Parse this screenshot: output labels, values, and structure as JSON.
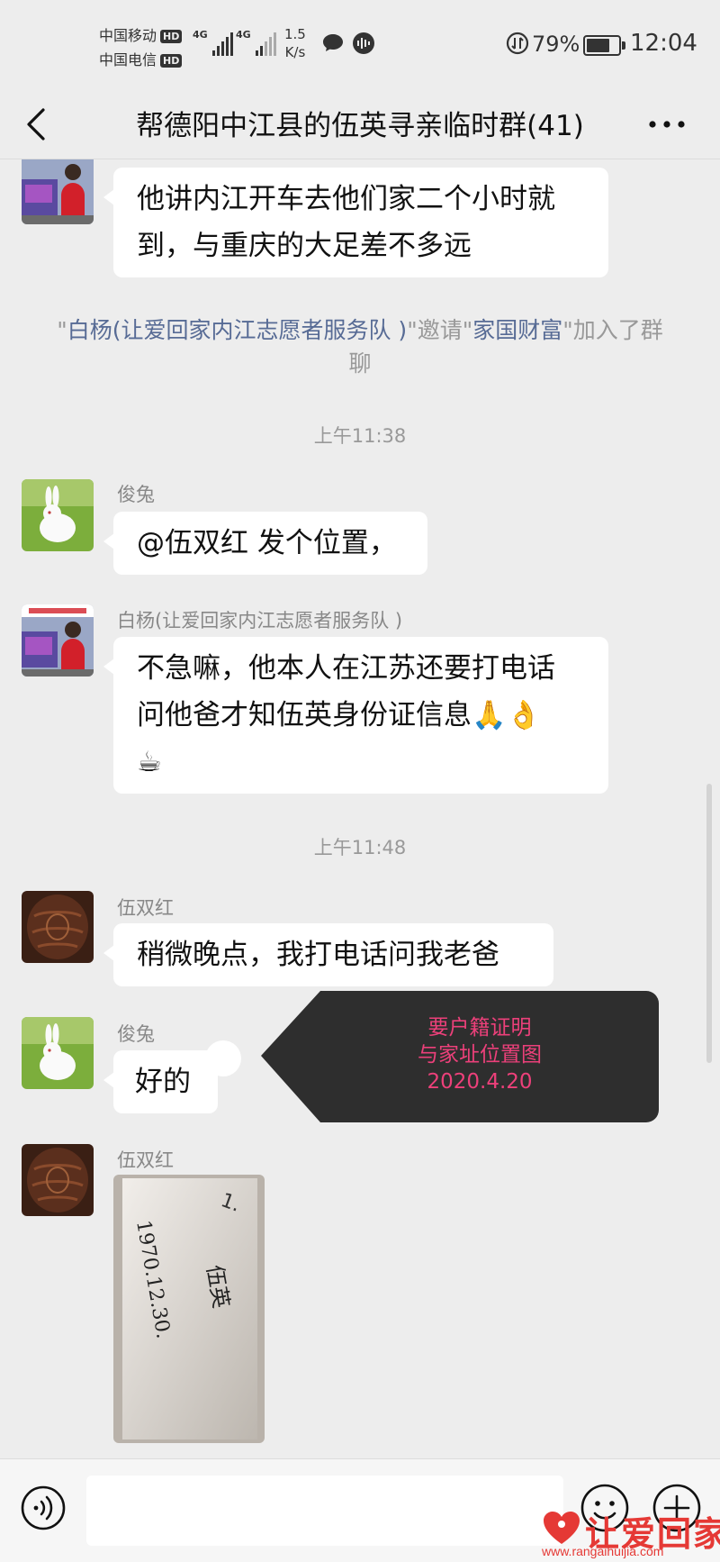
{
  "status_bar": {
    "carrier1": "中国移动",
    "carrier2": "中国电信",
    "hd": "HD",
    "net1": "4G",
    "net2": "4G",
    "speed_value": "1.5",
    "speed_unit": "K/s",
    "battery_percent": "79%",
    "battery_level": 0.79,
    "time": "12:04"
  },
  "header": {
    "title": "帮德阳中江县的伍英寻亲临时群(41)"
  },
  "messages": [
    {
      "sender": "",
      "text_lines": [
        "他讲内江开车去他们家二个小时就",
        "到，与重庆的大足差不多远"
      ],
      "avatar": "volunteer-avatar"
    },
    {
      "sender": "俊兔",
      "text_lines": [
        "@伍双红  发个位置，"
      ],
      "avatar": "rabbit-avatar"
    },
    {
      "sender": "白杨(让爱回家内江志愿者服务队 )",
      "text_lines": [
        "不急嘛，他本人在江苏还要打电话",
        "问他爸才知伍英身份证信息🙏👌",
        "☕"
      ],
      "avatar": "volunteer-avatar"
    },
    {
      "sender": "伍双红",
      "text_lines": [
        "稍微晚点，我打电话问我老爸"
      ],
      "avatar": "wood-avatar"
    },
    {
      "sender": "俊兔",
      "text_lines": [
        "好的"
      ],
      "avatar": "rabbit-avatar"
    },
    {
      "sender": "伍双红",
      "text_lines": [],
      "avatar": "wood-avatar",
      "photo": true
    }
  ],
  "system_message": {
    "q1": "\"",
    "inviter": "白杨(让爱回家内江志愿者服务队 )",
    "q2": "\"",
    "verb": "邀请",
    "q3": "\"",
    "invitee": "家国财富",
    "q4": "\"",
    "suffix": "加入了群聊"
  },
  "timestamps": [
    "上午11:38",
    "上午11:48"
  ],
  "note": {
    "line1": "要户籍证明",
    "line2": "与家址位置图",
    "line3": "2020.4.20"
  },
  "photo_handwriting": {
    "line1": "1970.12.30.",
    "line2": "伍英",
    "corner": "1."
  },
  "input": {
    "placeholder": ""
  },
  "watermark": {
    "title": "让爱回家",
    "url": "www.rangaihuijia.com"
  },
  "colors": {
    "background": "#ededed",
    "bubble": "#ffffff",
    "system_name": "#576b95",
    "note_text": "#ec407a",
    "note_bg": "#2e2e2e",
    "watermark": "#e53935"
  }
}
